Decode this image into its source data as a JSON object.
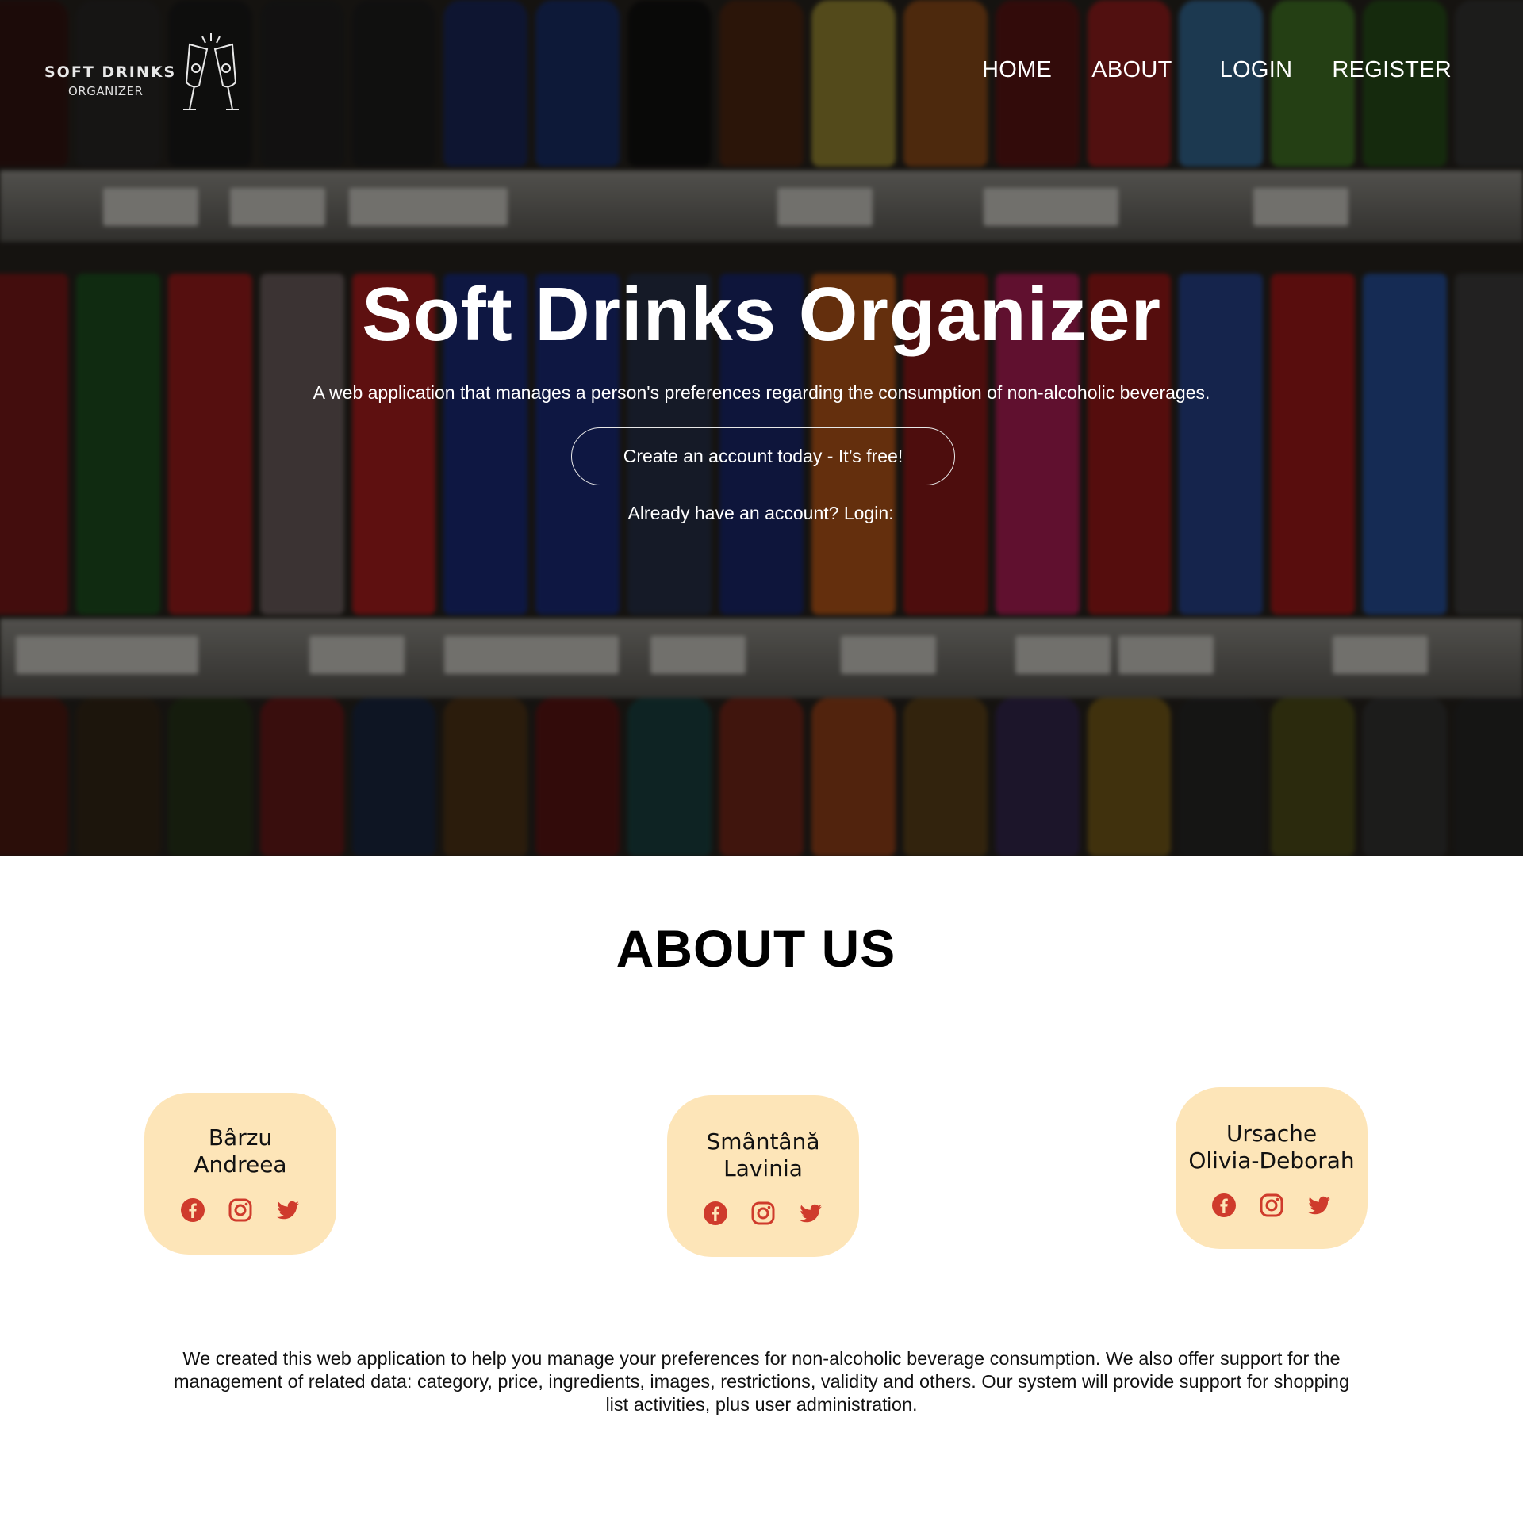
{
  "brand": {
    "title": "SOFT DRINKS",
    "subtitle": "ORGANIZER"
  },
  "nav": {
    "home": "HOME",
    "about": "ABOUT",
    "login": "LOGIN",
    "register": "REGISTER"
  },
  "hero": {
    "title": "Soft Drinks Organizer",
    "subtitle": "A web application that manages a person's preferences regarding the consumption of non-alcoholic beverages.",
    "cta": "Create an account today - It’s free!",
    "login_prompt": "Already have an account? Login:"
  },
  "about": {
    "title": "ABOUT US",
    "members": [
      {
        "first": "Bârzu",
        "last": "Andreea"
      },
      {
        "first": "Smântână",
        "last": "Lavinia"
      },
      {
        "first": "Ursache",
        "last": "Olivia-Deborah"
      }
    ],
    "social_icons": [
      "facebook-icon",
      "instagram-icon",
      "twitter-icon"
    ],
    "text": "We created this web application to help you manage your preferences for non-alcoholic beverage consumption. We also offer support for the management of related data: category, price, ingredients, images, restrictions, validity and others. Our system will provide support for shopping list activities, plus user administration."
  },
  "colors": {
    "card_bg": "#fde5b8",
    "icon_red": "#cf3b2c",
    "overlay": "rgba(0,0,0,0.48)"
  }
}
